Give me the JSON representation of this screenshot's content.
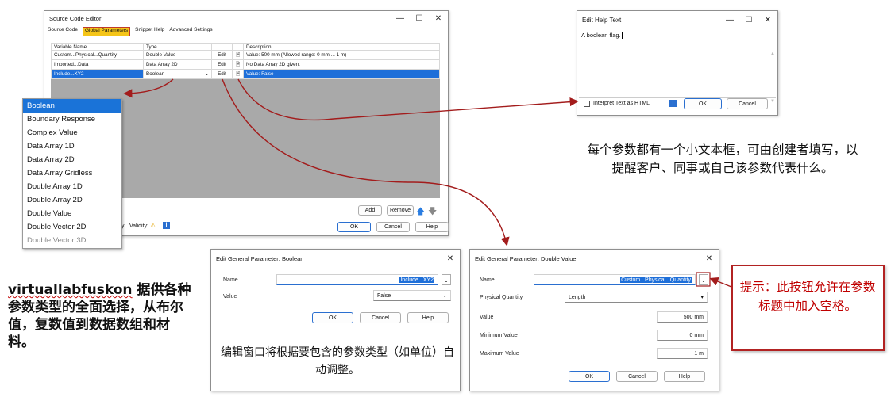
{
  "source_editor": {
    "title": "Source Code Editor",
    "tabs": [
      "Source Code",
      "Global Parameters",
      "Snippet Help",
      "Advanced Settings"
    ],
    "columns": [
      "Variable Name",
      "Type",
      "",
      "",
      "Description"
    ],
    "rows": [
      {
        "name": "Custom...Physical...Quantity",
        "type": "Double Value",
        "edit": "Edit",
        "desc": "Value: 500 mm (Allowed range: 0 mm ... 1 m)"
      },
      {
        "name": "Imported...Data",
        "type": "Data Array 2D",
        "edit": "Edit",
        "desc": "No Data Array 2D given."
      },
      {
        "name": "Include...XY2",
        "type": "Boolean",
        "edit": "Edit",
        "desc": "Value: False"
      }
    ],
    "add": "Add",
    "remove": "Remove",
    "status_partial": "y",
    "validity": "Validity:",
    "ok": "OK",
    "cancel": "Cancel",
    "help": "Help"
  },
  "type_dropdown": {
    "items": [
      "Boolean",
      "Boundary Response",
      "Complex Value",
      "Data Array 1D",
      "Data Array 2D",
      "Data Array Gridless",
      "Double Array 1D",
      "Double Array 2D",
      "Double Value",
      "Double Vector 2D",
      "Double Vector 3D"
    ]
  },
  "help_text_dialog": {
    "title": "Edit Help Text",
    "text": "A boolean flag.",
    "checkbox": "Interpret Text as HTML",
    "ok": "OK",
    "cancel": "Cancel"
  },
  "bool_dialog": {
    "title": "Edit General Parameter: Boolean",
    "name_label": "Name",
    "name_value": "Include...XY2",
    "value_label": "Value",
    "value": "False",
    "ok": "OK",
    "cancel": "Cancel",
    "help": "Help"
  },
  "double_dialog": {
    "title": "Edit General Parameter: Double Value",
    "name_label": "Name",
    "name_value": "Custom...Physical...Quantity",
    "pq_label": "Physical Quantity",
    "pq_value": "Length",
    "value_label": "Value",
    "value": "500 mm",
    "min_label": "Minimum Value",
    "min": "0 mm",
    "max_label": "Maximum Value",
    "max": "1 m",
    "ok": "OK",
    "cancel": "Cancel",
    "help": "Help"
  },
  "annotations": {
    "help_text_note": "每个参数都有一个小文本框，可由创建者填写，以提醒客户、同事或自己该参数代表什么。",
    "types_note_brand": "virtuallabfuskon",
    "types_note": " 据供各种参数类型的全面选择，从布尔值，复数值到数据数组和材料。",
    "edit_window_note": "编辑窗口将根据要包含的参数类型（如单位）自动调整。",
    "tip_note": "提示：此按钮允许在参数标题中加入空格。"
  },
  "colors": {
    "accent": "#1e6fd9",
    "arrow": "#a31c1c",
    "tip_border": "#b22222",
    "tip_text": "#c00000",
    "tab_highlight": "#f5c518"
  }
}
